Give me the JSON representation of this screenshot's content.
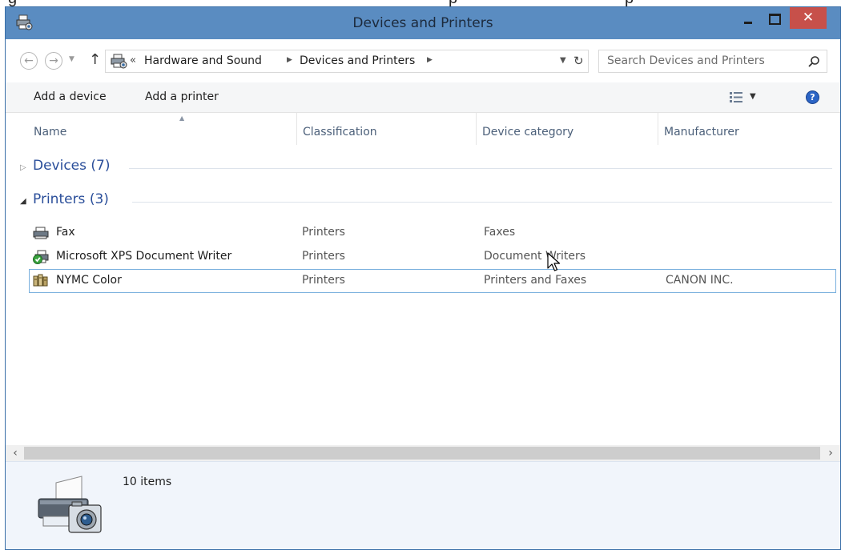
{
  "window": {
    "title": "Devices and Printers"
  },
  "titlebar": {
    "minimize_glyph": "",
    "maximize_glyph": "",
    "close_glyph": "✕"
  },
  "address": {
    "overflow_chevron": "«",
    "crumbs": [
      "Hardware and Sound",
      "Devices and Printers"
    ]
  },
  "search": {
    "placeholder": "Search Devices and Printers"
  },
  "commandbar": {
    "add_device": "Add a device",
    "add_printer": "Add a printer",
    "help": "?"
  },
  "columns": {
    "name": "Name",
    "classification": "Classification",
    "device_category": "Device category",
    "manufacturer": "Manufacturer"
  },
  "groups": [
    {
      "title": "Devices (7)",
      "expanded": false
    },
    {
      "title": "Printers (3)",
      "expanded": true
    }
  ],
  "printers": [
    {
      "name": "Fax",
      "classification": "Printers",
      "category": "Faxes",
      "manufacturer": "",
      "icon": "fax-icon",
      "selected": false
    },
    {
      "name": "Microsoft XPS Document Writer",
      "classification": "Printers",
      "category": "Document Writers",
      "manufacturer": "",
      "icon": "default-printer-icon",
      "selected": false
    },
    {
      "name": "NYMC Color",
      "classification": "Printers",
      "category": "Printers and Faxes",
      "manufacturer": "CANON INC.",
      "icon": "network-printer-icon",
      "selected": true
    }
  ],
  "details": {
    "item_count": "10 items"
  },
  "colors": {
    "titlebar": "#5a8cc1",
    "close_button": "#c7504a",
    "group_title": "#2a4e9a",
    "selection_border": "#7ab0de",
    "details_pane": "#f1f5fb"
  }
}
